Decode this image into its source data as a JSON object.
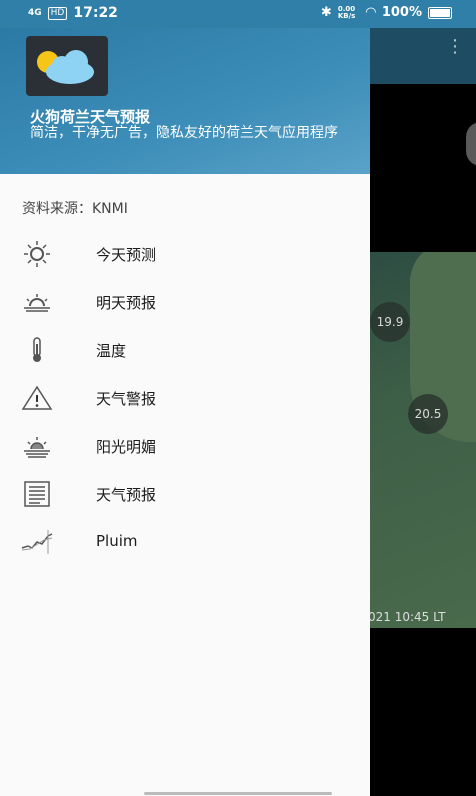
{
  "status_bar": {
    "network": "4G",
    "hd": "HD",
    "time": "17:22",
    "speed": "0.00 KB/s",
    "battery": "100%"
  },
  "drawer": {
    "app_title": "火狗荷兰天气预报",
    "app_desc": "简洁，干净无广告，隐私友好的荷兰天气应用程序",
    "source": "资料来源：KNMI",
    "items": [
      {
        "label": "今天预测",
        "icon": "sun-icon"
      },
      {
        "label": "明天预报",
        "icon": "sunrise-icon"
      },
      {
        "label": "温度",
        "icon": "thermometer-icon"
      },
      {
        "label": "天气警报",
        "icon": "warning-icon"
      },
      {
        "label": "阳光明媚",
        "icon": "sunny-icon"
      },
      {
        "label": "天气预报",
        "icon": "report-icon"
      },
      {
        "label": "Pluim",
        "icon": "plume-chart-icon"
      }
    ]
  },
  "background": {
    "map_labels": [
      "19.9",
      "20.5"
    ],
    "map_timestamp": "021 10:45 LT"
  },
  "colors": {
    "header": "#2b7aa5",
    "drawer_bg": "#fafafa",
    "app_bar": "#1e4d63"
  }
}
